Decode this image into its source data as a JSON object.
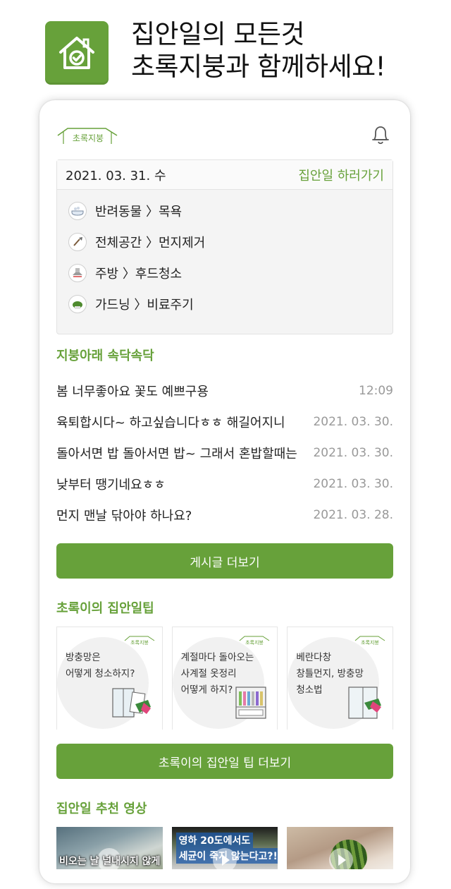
{
  "promo": {
    "headline_line1": "집안일의 모든것",
    "headline_line2": "초록지붕과 함께하세요!"
  },
  "app": {
    "logo_text": "초록지붕",
    "schedule": {
      "date": "2021. 03. 31. 수",
      "link_label": "집안일 하러가기",
      "tasks": [
        {
          "label": "반려동물 〉목욕",
          "icon": "bathtub-icon"
        },
        {
          "label": "전체공간 〉먼지제거",
          "icon": "duster-icon"
        },
        {
          "label": "주방 〉후드청소",
          "icon": "range-hood-icon"
        },
        {
          "label": "가드닝 〉비료주기",
          "icon": "plant-icon"
        }
      ]
    },
    "board": {
      "title": "지붕아래 속닥속닥",
      "posts": [
        {
          "title": "봄 너무좋아요 꽃도 예쁘구용",
          "date": "12:09"
        },
        {
          "title": "육퇴합시다~ 하고싶습니다ㅎㅎ 해길어지니",
          "date": "2021. 03. 30."
        },
        {
          "title": "돌아서면 밥 돌아서면 밥~ 그래서 혼밥할때는",
          "date": "2021. 03. 30."
        },
        {
          "title": "낮부터 땡기네요ㅎㅎ",
          "date": "2021. 03. 30."
        },
        {
          "title": "먼지 맨날 닦아야 하나요?",
          "date": "2021. 03. 28."
        }
      ],
      "more_button": "게시글 더보기"
    },
    "tips": {
      "title": "초록이의 집안일팁",
      "cards": [
        {
          "line1": "방충망은",
          "line2": "어떻게 청소하지?",
          "line3": ""
        },
        {
          "line1": "계절마다 돌아오는",
          "line2": "사계절 옷정리",
          "line3": "어떻게 하지?"
        },
        {
          "line1": "베란다창",
          "line2": "창틀먼지, 방충망",
          "line3": "청소법"
        }
      ],
      "more_button": "초록이의 집안일 팁 더보기"
    },
    "videos": {
      "title": "집안일 추천 영상",
      "items": [
        {
          "overlay": "비오는 날 널내시지 않게"
        },
        {
          "caption_top": "영하 20도에서도",
          "caption_mid": "세균이 죽지 않는다고?!"
        },
        {
          "overlay": ""
        }
      ]
    }
  },
  "colors": {
    "brand_green": "#67a13a",
    "muted_text": "#999999"
  }
}
